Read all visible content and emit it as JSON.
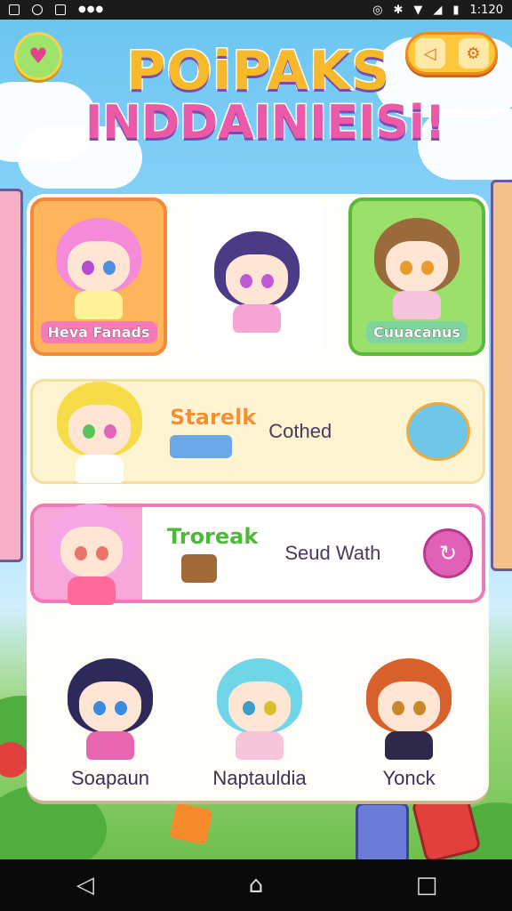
{
  "status_bar": {
    "time": "1:120",
    "left_icons": [
      "notification-icon",
      "sync-icon",
      "sd-card-icon",
      "more-dots-icon"
    ],
    "right_icons": [
      "alarm-icon",
      "bluetooth-icon",
      "wifi-icon",
      "signal-icon",
      "battery-icon"
    ]
  },
  "header": {
    "title_line1": "POiPAKS",
    "title_line2": "INDDAINIEISi!",
    "left_button_icon": "home-heart-icon",
    "right_buttons": [
      "sound-icon",
      "settings-icon"
    ]
  },
  "characters_top": [
    {
      "label": "Heva Fanads",
      "hair": "#f58ad8",
      "eyes": "#b44bd0",
      "bg": "#ffb55a"
    },
    {
      "label": "",
      "hair": "#4b3a86",
      "eyes": "#c158d6",
      "bg": "#ffffff"
    },
    {
      "label": "Cuuacanus",
      "hair": "#9a6a3a",
      "eyes": "#e89a2a",
      "bg": "#9be06a"
    }
  ],
  "row_1": {
    "title": "Starelk",
    "subtitle": "Cothed",
    "hair": "#f7dc4a"
  },
  "row_2": {
    "title": "Troreak",
    "subtitle": "Seud Wath",
    "hair": "#f7a8e4"
  },
  "characters_bottom": [
    {
      "name": "Soapaun",
      "hair": "#2d2a5a"
    },
    {
      "name": "Naptauldia",
      "hair": "#6fd6e8"
    },
    {
      "name": "Yonck",
      "hair": "#d8602a"
    }
  ],
  "navbar": {
    "back": "◁",
    "home": "⌂",
    "recents": "□"
  },
  "colors": {
    "accent_pink": "#e85aa8",
    "accent_yellow": "#ffc83a",
    "accent_green": "#9ee36a"
  }
}
